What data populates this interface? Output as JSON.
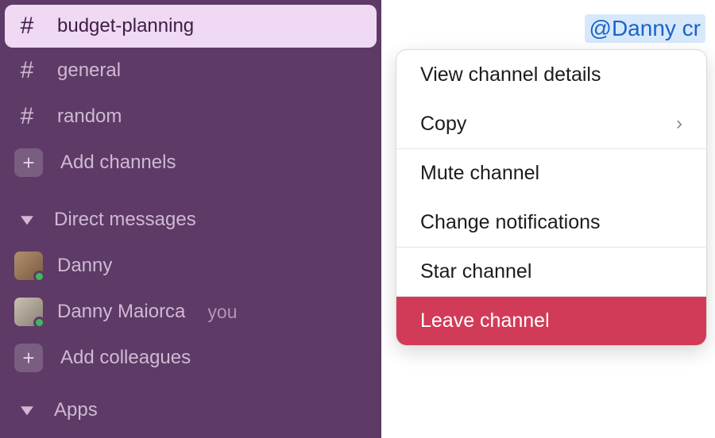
{
  "sidebar": {
    "channels": [
      {
        "name": "budget-planning",
        "selected": true
      },
      {
        "name": "general",
        "selected": false
      },
      {
        "name": "random",
        "selected": false
      }
    ],
    "add_channels": "Add channels",
    "dm_header": "Direct messages",
    "dms": [
      {
        "name": "Danny",
        "you": false
      },
      {
        "name": "Danny Maiorca",
        "you": true
      }
    ],
    "you_label": "you",
    "add_colleagues": "Add colleagues",
    "apps_header": "Apps"
  },
  "main": {
    "mention_fragment": "@Danny  cr"
  },
  "menu": {
    "view_details": "View channel details",
    "copy": "Copy",
    "mute": "Mute channel",
    "change_notifications": "Change notifications",
    "star": "Star channel",
    "leave": "Leave channel"
  }
}
